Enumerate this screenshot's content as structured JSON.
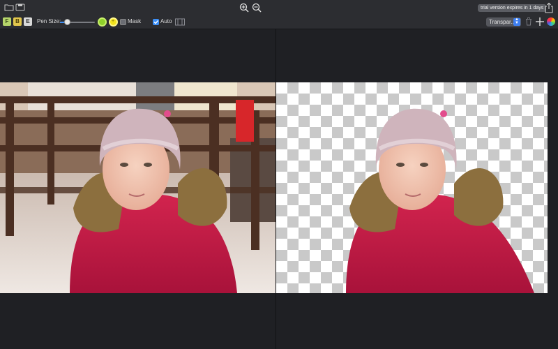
{
  "titlebar": {
    "trial_text": "trial version expires in 1 days"
  },
  "toolbar": {
    "mode_buttons": [
      {
        "label": "F",
        "color": "#b6d56a"
      },
      {
        "label": "B",
        "color": "#e2c74d"
      },
      {
        "label": "E",
        "color": "#d9d9d9"
      }
    ],
    "pen_size_label": "Pen Size:",
    "pen_size_level": 0.2,
    "mask_label": "Mask",
    "mask_checked": false,
    "auto_label": "Auto",
    "auto_checked": true,
    "background_select": "Transpar..."
  },
  "colors": {
    "window_bg": "#1f2024",
    "toolbar_bg": "#2c2d31",
    "accent": "#3d8ff5",
    "foreground_marker": "#8fd12a",
    "background_marker": "#f2e31d"
  },
  "icons": [
    "folder-icon",
    "save-icon",
    "zoom-in-icon",
    "zoom-out-icon",
    "share-icon",
    "trash-icon",
    "add-icon",
    "color-wheel-icon"
  ]
}
